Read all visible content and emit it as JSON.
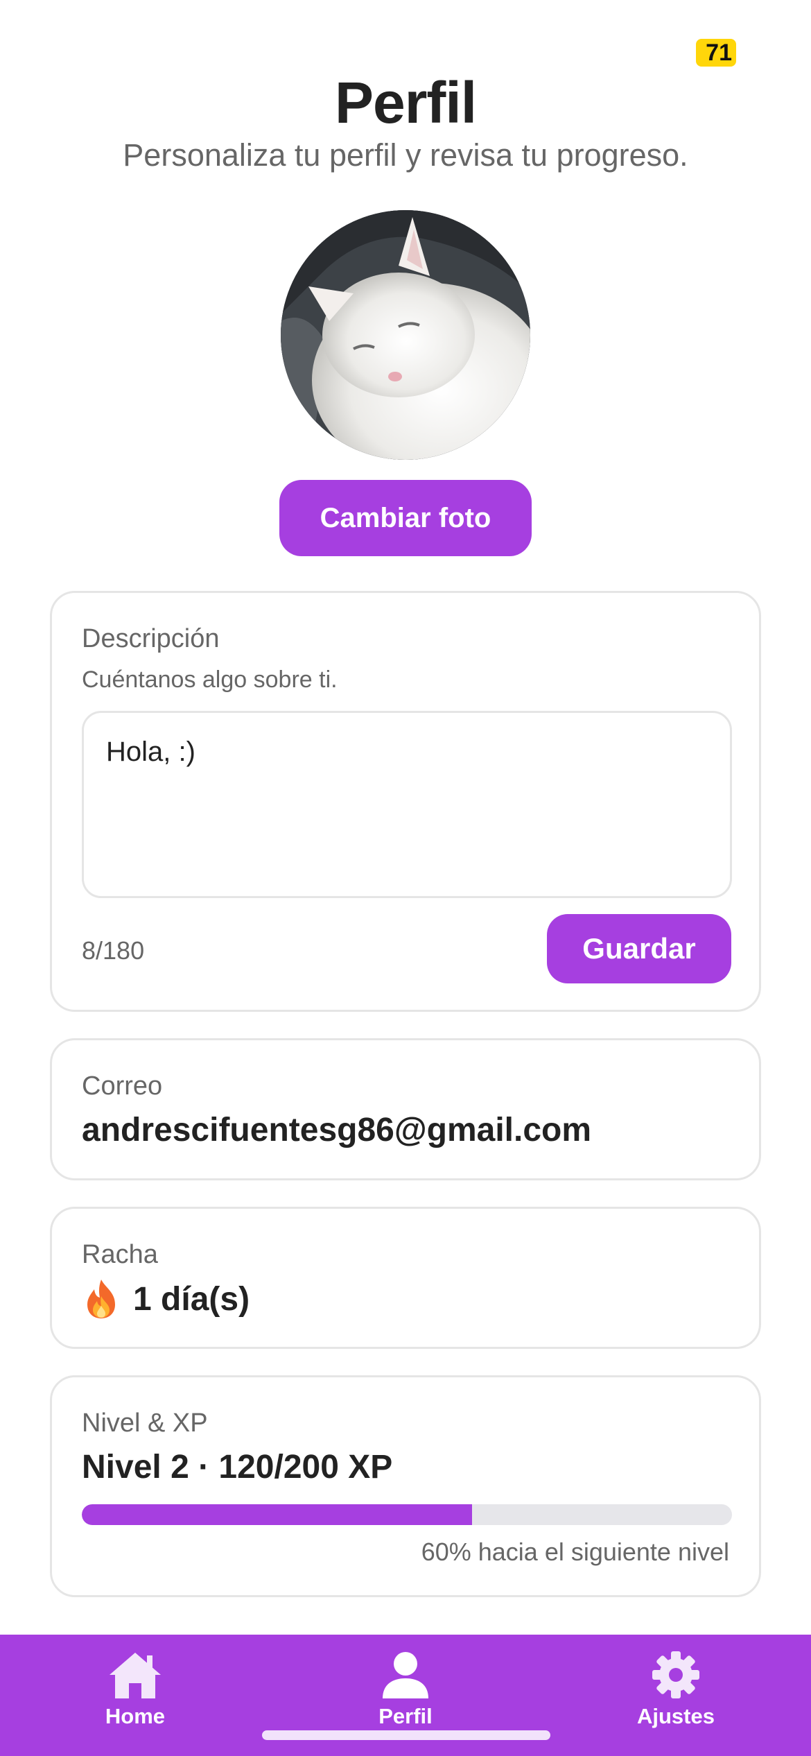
{
  "status": {
    "badge": "71"
  },
  "header": {
    "title": "Perfil",
    "subtitle": "Personaliza tu perfil y revisa tu progreso."
  },
  "avatar": {
    "change_photo_label": "Cambiar foto"
  },
  "description_card": {
    "label": "Descripción",
    "hint": "Cuéntanos algo sobre ti.",
    "value": "Hola, :)",
    "counter": "8/180",
    "save_label": "Guardar"
  },
  "email_card": {
    "label": "Correo",
    "value": "andrescifuentesg86@gmail.com"
  },
  "streak_card": {
    "label": "Racha",
    "icon": "fire-icon",
    "value": "1 día(s)"
  },
  "level_card": {
    "label": "Nivel & XP",
    "value": "Nivel 2 · 120/200 XP",
    "progress_fraction": 0.6,
    "caption": "60% hacia el siguiente nivel"
  },
  "tabbar": {
    "items": [
      {
        "label": "Home",
        "icon": "home-icon"
      },
      {
        "label": "Perfil",
        "icon": "person-icon",
        "active": true
      },
      {
        "label": "Ajustes",
        "icon": "gear-icon"
      }
    ]
  },
  "colors": {
    "accent": "#a63fe0",
    "badge": "#ffd60a",
    "progress_track": "#e6e6ea"
  }
}
